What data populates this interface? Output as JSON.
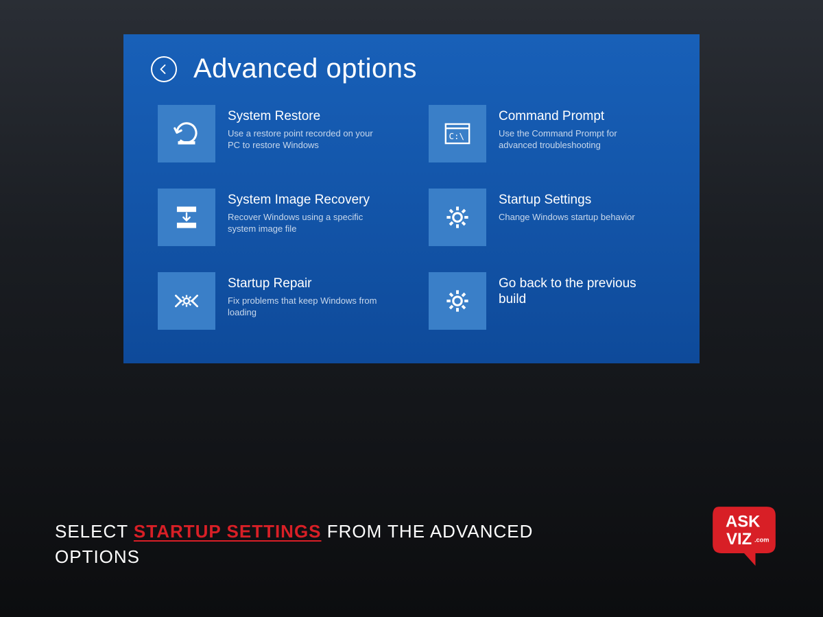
{
  "header": {
    "title": "Advanced options"
  },
  "options": [
    {
      "title": "System Restore",
      "desc": "Use a restore point recorded on your PC to restore Windows",
      "icon": "restore"
    },
    {
      "title": "Command Prompt",
      "desc": "Use the Command Prompt for advanced troubleshooting",
      "icon": "cmd"
    },
    {
      "title": "System Image Recovery",
      "desc": "Recover Windows using a specific system image file",
      "icon": "image-recovery"
    },
    {
      "title": "Startup Settings",
      "desc": "Change Windows startup behavior",
      "icon": "gear"
    },
    {
      "title": "Startup Repair",
      "desc": "Fix problems that keep Windows from loading",
      "icon": "repair"
    },
    {
      "title": "Go back to the previous build",
      "desc": "",
      "icon": "gear"
    }
  ],
  "caption": {
    "pre": "SELECT ",
    "highlight": "STARTUP SETTINGS",
    "post": " FROM THE ADVANCED OPTIONS"
  },
  "logo": {
    "line1": "ASK",
    "line2": "VIZ",
    "sub": ".com"
  }
}
